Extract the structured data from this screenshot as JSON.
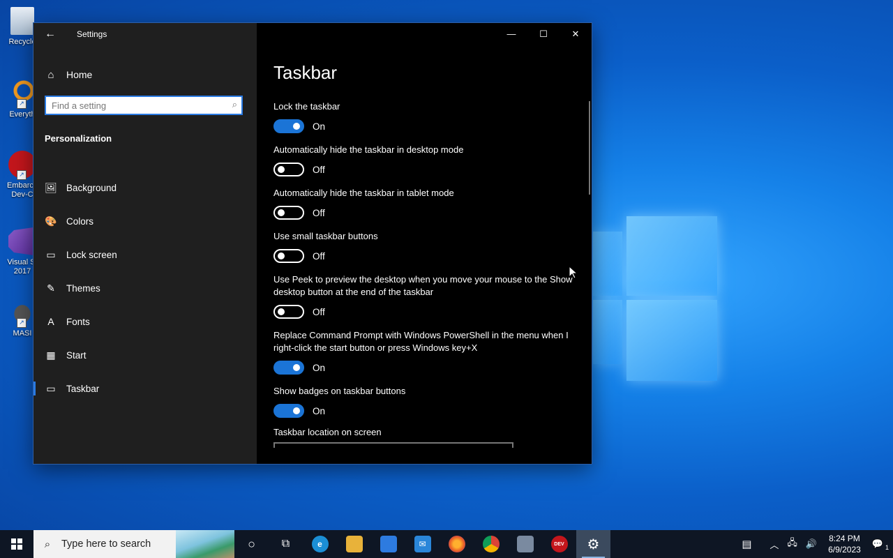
{
  "desktop": {
    "icons": [
      {
        "label": "Recycle",
        "icon": "recycle-bin-icon"
      },
      {
        "label": "Everyth",
        "icon": "everything-search-icon"
      },
      {
        "label": "Embarca Dev-C",
        "icon": "dev-cpp-icon"
      },
      {
        "label": "Visual St 2017",
        "icon": "visual-studio-icon"
      },
      {
        "label": "MASI",
        "icon": "masm-icon"
      }
    ]
  },
  "window": {
    "title": "Settings",
    "controls": {
      "minimize": "—",
      "maximize": "☐",
      "close": "✕"
    }
  },
  "sidebar": {
    "home_label": "Home",
    "search_placeholder": "Find a setting",
    "section_title": "Personalization",
    "items": [
      {
        "label": "Background",
        "icon": "image-icon",
        "glyph": "🖼"
      },
      {
        "label": "Colors",
        "icon": "palette-icon",
        "glyph": "🎨"
      },
      {
        "label": "Lock screen",
        "icon": "lock-screen-icon",
        "glyph": "▭"
      },
      {
        "label": "Themes",
        "icon": "themes-icon",
        "glyph": "✎"
      },
      {
        "label": "Fonts",
        "icon": "fonts-icon",
        "glyph": "A"
      },
      {
        "label": "Start",
        "icon": "start-icon",
        "glyph": "▦"
      },
      {
        "label": "Taskbar",
        "icon": "taskbar-icon",
        "glyph": "▭",
        "active": true
      }
    ]
  },
  "main": {
    "title": "Taskbar",
    "settings": [
      {
        "label": "Lock the taskbar",
        "state": "On",
        "on": true
      },
      {
        "label": "Automatically hide the taskbar in desktop mode",
        "state": "Off",
        "on": false
      },
      {
        "label": "Automatically hide the taskbar in tablet mode",
        "state": "Off",
        "on": false
      },
      {
        "label": "Use small taskbar buttons",
        "state": "Off",
        "on": false
      },
      {
        "label": "Use Peek to preview the desktop when you move your mouse to the Show desktop button at the end of the taskbar",
        "state": "Off",
        "on": false
      },
      {
        "label": "Replace Command Prompt with Windows PowerShell in the menu when I right-click the start button or press Windows key+X",
        "state": "On",
        "on": true
      },
      {
        "label": "Show badges on taskbar buttons",
        "state": "On",
        "on": true
      }
    ],
    "location_label": "Taskbar location on screen"
  },
  "taskbar": {
    "search_placeholder": "Type here to search",
    "apps": [
      {
        "name": "cortana-icon",
        "glyph": "○",
        "color": "transparent"
      },
      {
        "name": "task-view-icon",
        "glyph": "⧉",
        "color": "transparent"
      },
      {
        "name": "edge-icon",
        "glyph": "e",
        "color": "#1b8fd6"
      },
      {
        "name": "file-explorer-icon",
        "glyph": "📁",
        "color": "#e8b23a"
      },
      {
        "name": "store-icon",
        "glyph": "🛍",
        "color": "#2d7be0"
      },
      {
        "name": "mail-icon",
        "glyph": "✉",
        "color": "#2a86d9"
      },
      {
        "name": "firefox-icon",
        "glyph": "●",
        "color": "#e85d27"
      },
      {
        "name": "chrome-icon",
        "glyph": "◉",
        "color": "#3aa757"
      },
      {
        "name": "network-tool-icon",
        "glyph": "▤",
        "color": "#7a8aa0"
      },
      {
        "name": "dev-cpp-icon",
        "glyph": "DEV",
        "color": "#c4161c"
      },
      {
        "name": "settings-icon",
        "glyph": "⚙",
        "color": "transparent"
      }
    ],
    "clock": {
      "time": "8:24 PM",
      "date": "6/9/2023"
    },
    "notification_count": "1"
  },
  "colors": {
    "accent": "#1b74d6",
    "sidebar": "#1f1f1f",
    "main": "#000000"
  }
}
